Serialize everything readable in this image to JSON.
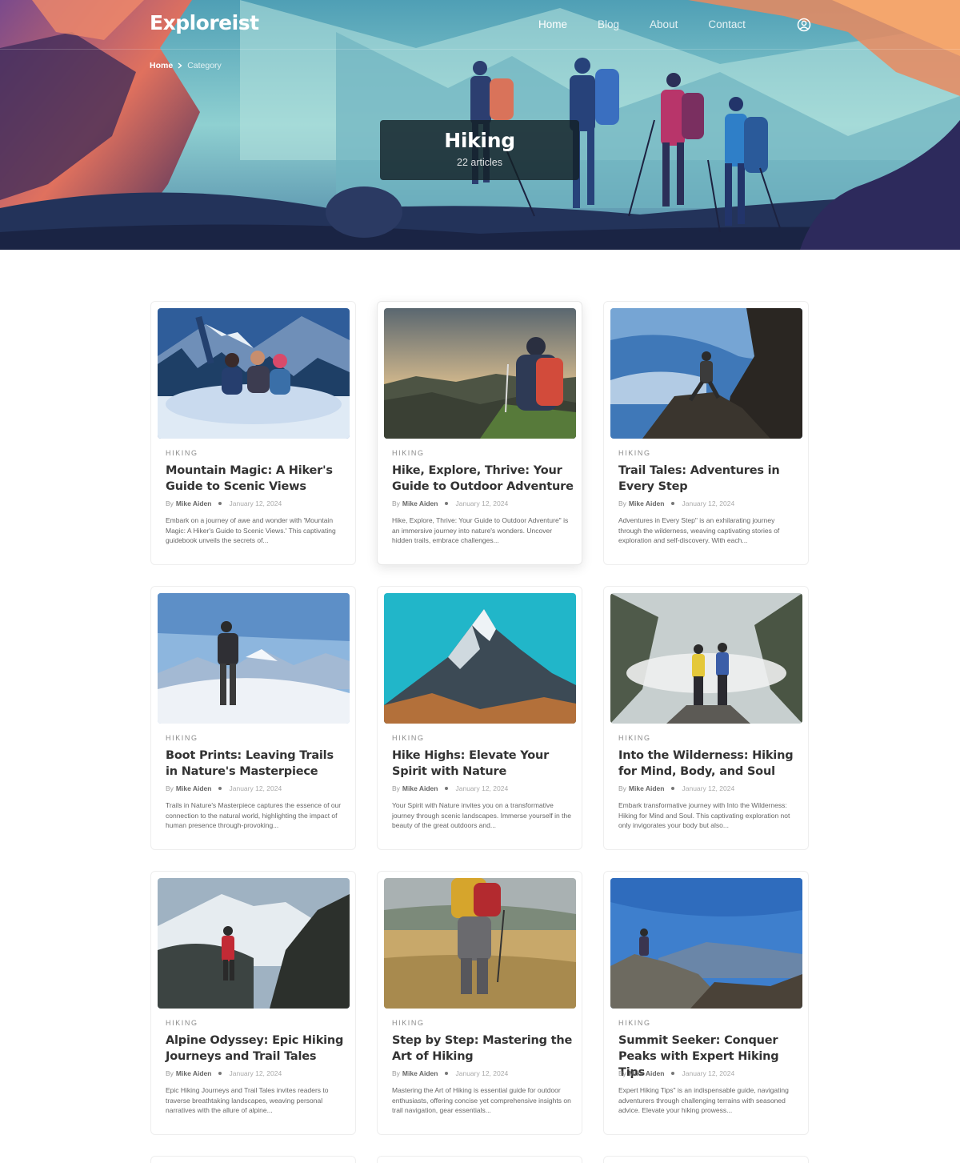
{
  "brand": {
    "logo_text": "Exploreist"
  },
  "nav": {
    "links": [
      {
        "label": "Home"
      },
      {
        "label": "Blog"
      },
      {
        "label": "About"
      },
      {
        "label": "Contact"
      }
    ],
    "user_icon": "user-circle-icon"
  },
  "breadcrumb": {
    "home": "Home",
    "current": "Category"
  },
  "hero": {
    "title": "Hiking",
    "count": "22 articles"
  },
  "cards": [
    {
      "category": "HIKING",
      "title": "Mountain Magic: A Hiker's Guide to Scenic Views",
      "by": "By",
      "author": "Mike Aiden",
      "date": "January 12, 2024",
      "excerpt": "Embark on a journey of awe and wonder with 'Mountain Magic: A Hiker's Guide to Scenic Views.' This captivating guidebook unveils the secrets of..."
    },
    {
      "category": "HIKING",
      "title": "Hike, Explore, Thrive: Your Guide to Outdoor Adventure",
      "by": "By",
      "author": "Mike Aiden",
      "date": "January 12, 2024",
      "excerpt": "Hike, Explore, Thrive: Your Guide to Outdoor Adventure\" is an immersive journey into nature's wonders. Uncover hidden trails, embrace challenges..."
    },
    {
      "category": "HIKING",
      "title": "Trail Tales: Adventures in Every Step",
      "by": "By",
      "author": "Mike Aiden",
      "date": "January 12, 2024",
      "excerpt": "Adventures in Every Step\" is an exhilarating journey through the wilderness, weaving captivating stories of exploration and self-discovery. With each..."
    },
    {
      "category": "HIKING",
      "title": "Boot Prints: Leaving Trails in Nature's Masterpiece",
      "by": "By",
      "author": "Mike Aiden",
      "date": "January 12, 2024",
      "excerpt": "Trails in Nature's Masterpiece captures the essence of our connection to the natural world, highlighting the impact of human presence through-provoking..."
    },
    {
      "category": "HIKING",
      "title": "Hike Highs: Elevate Your Spirit with Nature",
      "by": "By",
      "author": "Mike Aiden",
      "date": "January 12, 2024",
      "excerpt": "Your Spirit with Nature invites you on a transformative journey through scenic landscapes. Immerse yourself in the beauty of the great outdoors and..."
    },
    {
      "category": "HIKING",
      "title": "Into the Wilderness: Hiking for Mind, Body, and Soul",
      "by": "By",
      "author": "Mike Aiden",
      "date": "January 12, 2024",
      "excerpt": "Embark transformative journey with Into the Wilderness: Hiking for Mind and Soul. This captivating exploration not only invigorates your body but also..."
    },
    {
      "category": "HIKING",
      "title": "Alpine Odyssey: Epic Hiking Journeys and Trail Tales",
      "by": "By",
      "author": "Mike Aiden",
      "date": "January 12, 2024",
      "excerpt": "Epic Hiking Journeys and Trail Tales invites readers to traverse breathtaking landscapes, weaving personal narratives with the allure of alpine..."
    },
    {
      "category": "HIKING",
      "title": "Step by Step: Mastering the Art of Hiking",
      "by": "By",
      "author": "Mike Aiden",
      "date": "January 12, 2024",
      "excerpt": "Mastering the Art of Hiking is essential guide for outdoor enthusiasts, offering concise yet comprehensive insights on trail navigation, gear essentials..."
    },
    {
      "category": "HIKING",
      "title": "Summit Seeker: Conquer Peaks with Expert Hiking Tips",
      "by": "By",
      "author": "Mike Aiden",
      "date": "January 12, 2024",
      "excerpt": "Expert Hiking Tips\" is an indispensable guide, navigating adventurers through challenging terrains with seasoned advice. Elevate your hiking prowess..."
    }
  ]
}
